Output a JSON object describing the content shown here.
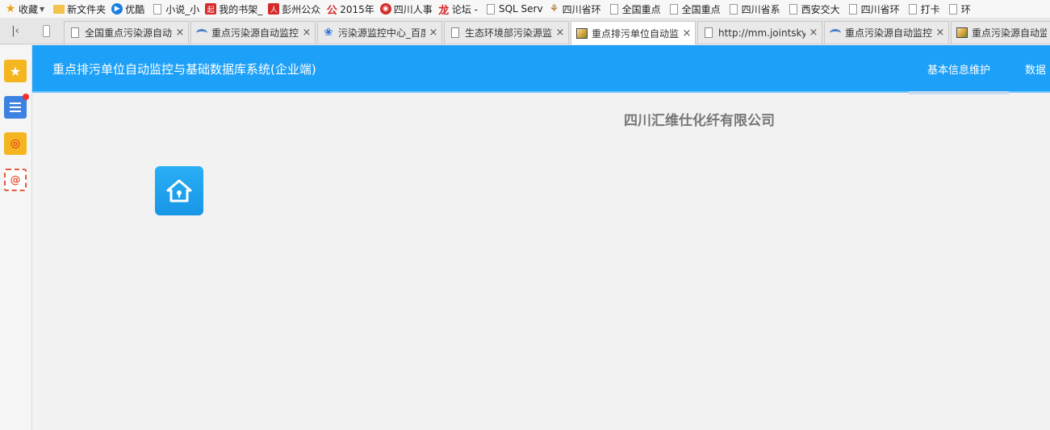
{
  "bookmarks": [
    {
      "label": "收藏",
      "icon": "star-icon"
    },
    {
      "label": "新文件夹",
      "icon": "folder-icon"
    },
    {
      "label": "优酷",
      "icon": "youku-icon"
    },
    {
      "label": "小说_小",
      "icon": "page-icon"
    },
    {
      "label": "我的书架_",
      "icon": "qidian-icon"
    },
    {
      "label": "彭州公众",
      "icon": "people-icon"
    },
    {
      "label": "2015年",
      "icon": "gong-icon"
    },
    {
      "label": "四川人事",
      "icon": "seal-icon"
    },
    {
      "label": "论坛 -",
      "icon": "dragon-icon"
    },
    {
      "label": "SQL Serv",
      "icon": "page-icon"
    },
    {
      "label": "四川省环",
      "icon": "grain-icon"
    },
    {
      "label": "全国重点",
      "icon": "page-icon"
    },
    {
      "label": "全国重点",
      "icon": "page-icon"
    },
    {
      "label": "四川省系",
      "icon": "page-icon"
    },
    {
      "label": "西安交大",
      "icon": "page-icon"
    },
    {
      "label": "四川省环",
      "icon": "page-icon"
    },
    {
      "label": "打卡",
      "icon": "page-icon"
    },
    {
      "label": "环",
      "icon": "page-icon"
    }
  ],
  "tabs": [
    {
      "label": "全国重点污染源自动",
      "icon": "page-icon",
      "active": false
    },
    {
      "label": "重点污染源自动监控",
      "icon": "wave-icon",
      "active": false
    },
    {
      "label": "污染源监控中心_百度",
      "icon": "paw-icon",
      "active": false
    },
    {
      "label": "生态环境部污染源监",
      "icon": "page-icon",
      "active": false
    },
    {
      "label": "重点排污单位自动监",
      "icon": "image-icon",
      "active": true
    },
    {
      "label": "http://mm.jointsky",
      "icon": "page-icon",
      "active": false
    },
    {
      "label": "重点污染源自动监控",
      "icon": "wave-icon",
      "active": false
    },
    {
      "label": "重点污染源自动监控",
      "icon": "image-icon",
      "active": false
    }
  ],
  "app": {
    "title": "重点排污单位自动监控与基础数据库系统(企业端)",
    "nav": [
      "基本信息维护",
      "数据"
    ]
  },
  "company": "四川汇维仕化纤有限公司",
  "colors": {
    "header": "#1da0f8",
    "tile": "#1796e6",
    "background": "#f2f2f2"
  }
}
